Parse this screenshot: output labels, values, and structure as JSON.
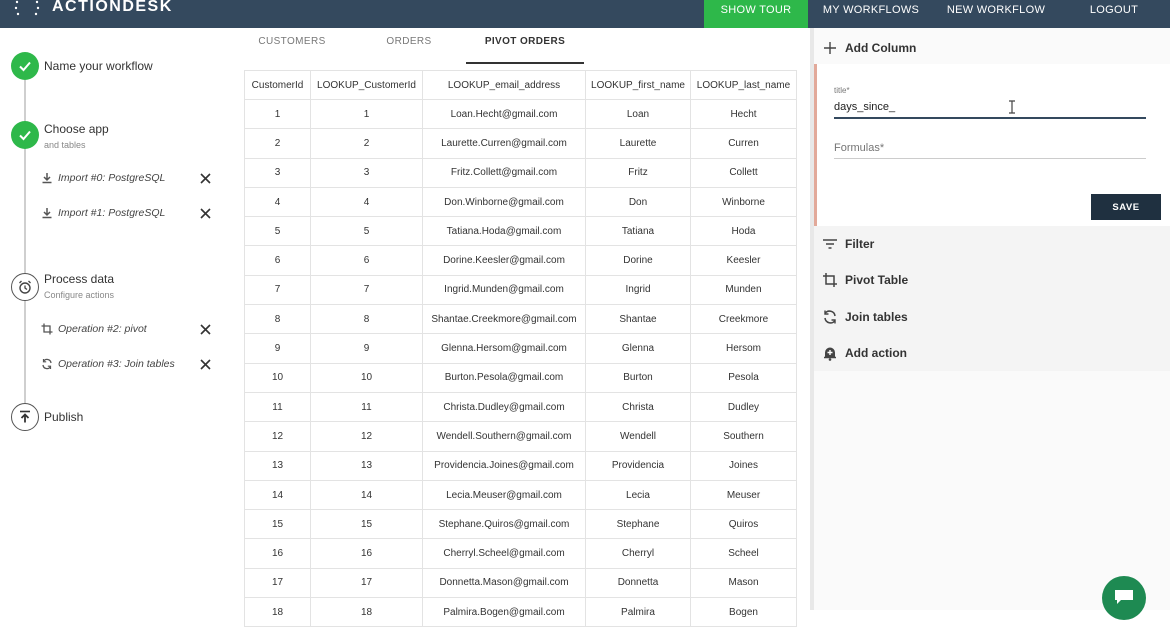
{
  "app": {
    "brand_name": "ACTIONDESK"
  },
  "nav": [
    {
      "label": "SHOW TOUR"
    },
    {
      "label": "MY WORKFLOWS"
    },
    {
      "label": "NEW WORKFLOW"
    },
    {
      "label": "LOGOUT"
    }
  ],
  "steps": {
    "name": {
      "title": "Name your workflow",
      "state": "done"
    },
    "app": {
      "title": "Choose app",
      "subtitle": "and tables",
      "state": "done"
    },
    "imports": [
      {
        "label": "Import #0: PostgreSQL",
        "icon": "download-icon"
      },
      {
        "label": "Import #1: PostgreSQL",
        "icon": "download-icon"
      }
    ],
    "process": {
      "title": "Process data",
      "subtitle": "Configure actions",
      "state": "current"
    },
    "operations": [
      {
        "label": "Operation #2: pivot",
        "icon": "crop-icon"
      },
      {
        "label": "Operation #3: Join tables",
        "icon": "refresh-icon"
      }
    ],
    "publish": {
      "title": "Publish",
      "state": "todo"
    }
  },
  "tabs": [
    {
      "label": "CUSTOMERS",
      "active": false
    },
    {
      "label": "ORDERS",
      "active": false
    },
    {
      "label": "PIVOT ORDERS",
      "active": true
    }
  ],
  "table": {
    "columns": [
      "CustomerId",
      "LOOKUP_CustomerId",
      "LOOKUP_email_address",
      "LOOKUP_first_name",
      "LOOKUP_last_name"
    ],
    "rows": [
      [
        "1",
        "1",
        "Loan.Hecht@gmail.com",
        "Loan",
        "Hecht"
      ],
      [
        "2",
        "2",
        "Laurette.Curren@gmail.com",
        "Laurette",
        "Curren"
      ],
      [
        "3",
        "3",
        "Fritz.Collett@gmail.com",
        "Fritz",
        "Collett"
      ],
      [
        "4",
        "4",
        "Don.Winborne@gmail.com",
        "Don",
        "Winborne"
      ],
      [
        "5",
        "5",
        "Tatiana.Hoda@gmail.com",
        "Tatiana",
        "Hoda"
      ],
      [
        "6",
        "6",
        "Dorine.Keesler@gmail.com",
        "Dorine",
        "Keesler"
      ],
      [
        "7",
        "7",
        "Ingrid.Munden@gmail.com",
        "Ingrid",
        "Munden"
      ],
      [
        "8",
        "8",
        "Shantae.Creekmore@gmail.com",
        "Shantae",
        "Creekmore"
      ],
      [
        "9",
        "9",
        "Glenna.Hersom@gmail.com",
        "Glenna",
        "Hersom"
      ],
      [
        "10",
        "10",
        "Burton.Pesola@gmail.com",
        "Burton",
        "Pesola"
      ],
      [
        "11",
        "11",
        "Christa.Dudley@gmail.com",
        "Christa",
        "Dudley"
      ],
      [
        "12",
        "12",
        "Wendell.Southern@gmail.com",
        "Wendell",
        "Southern"
      ],
      [
        "13",
        "13",
        "Providencia.Joines@gmail.com",
        "Providencia",
        "Joines"
      ],
      [
        "14",
        "14",
        "Lecia.Meuser@gmail.com",
        "Lecia",
        "Meuser"
      ],
      [
        "15",
        "15",
        "Stephane.Quiros@gmail.com",
        "Stephane",
        "Quiros"
      ],
      [
        "16",
        "16",
        "Cherryl.Scheel@gmail.com",
        "Cherryl",
        "Scheel"
      ],
      [
        "17",
        "17",
        "Donnetta.Mason@gmail.com",
        "Donnetta",
        "Mason"
      ],
      [
        "18",
        "18",
        "Palmira.Bogen@gmail.com",
        "Palmira",
        "Bogen"
      ]
    ]
  },
  "panel": {
    "add_column": {
      "label": "Add Column",
      "icon": "plus-icon"
    },
    "form": {
      "title_label": "title*",
      "title_value": "days_since_",
      "formulas_placeholder": "Formulas*",
      "save_label": "SAVE"
    },
    "actions": [
      {
        "label": "Filter",
        "icon": "filter-icon"
      },
      {
        "label": "Pivot Table",
        "icon": "crop-icon"
      },
      {
        "label": "Join tables",
        "icon": "refresh-icon"
      },
      {
        "label": "Add action",
        "icon": "bell-plus-icon"
      }
    ]
  },
  "colors": {
    "topbar": "#34495e",
    "accent_green": "#2eb84a",
    "save_button": "#1f3040",
    "chat_button": "#1e8a52"
  }
}
